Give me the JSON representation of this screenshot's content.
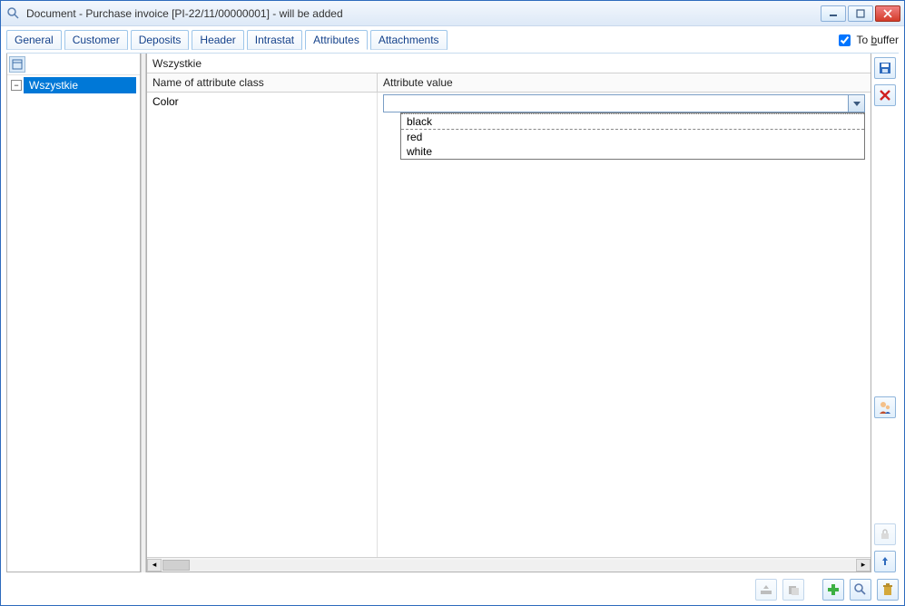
{
  "window": {
    "title": "Document - Purchase invoice [PI-22/11/00000001]  - will be added"
  },
  "tabs": [
    {
      "label": "General"
    },
    {
      "label": "Customer"
    },
    {
      "label": "Deposits"
    },
    {
      "label": "Header"
    },
    {
      "label": "Intrastat"
    },
    {
      "label": "Attributes"
    },
    {
      "label": "Attachments"
    }
  ],
  "active_tab_index": 5,
  "buffer": {
    "label": "To buffer",
    "checked": true
  },
  "tree": {
    "root_header": "Wszystkie",
    "nodes": [
      {
        "label": "Wszystkie",
        "expanded": true,
        "selected": true
      }
    ]
  },
  "grid": {
    "header_name": "Name of attribute class",
    "header_value": "Attribute value",
    "rows": [
      {
        "name": "Color",
        "value": ""
      }
    ],
    "dropdown_options": [
      "black",
      "red",
      "white"
    ]
  },
  "right_buttons": {
    "save": "save-icon",
    "cancel": "close-x-icon",
    "user": "person-icon",
    "lock": "lock-icon",
    "pin": "pin-icon"
  },
  "bottom_buttons": {
    "open": "open-icon",
    "paste": "paste-icon",
    "add": "plus-icon",
    "find": "search-icon",
    "delete": "trash-icon"
  }
}
